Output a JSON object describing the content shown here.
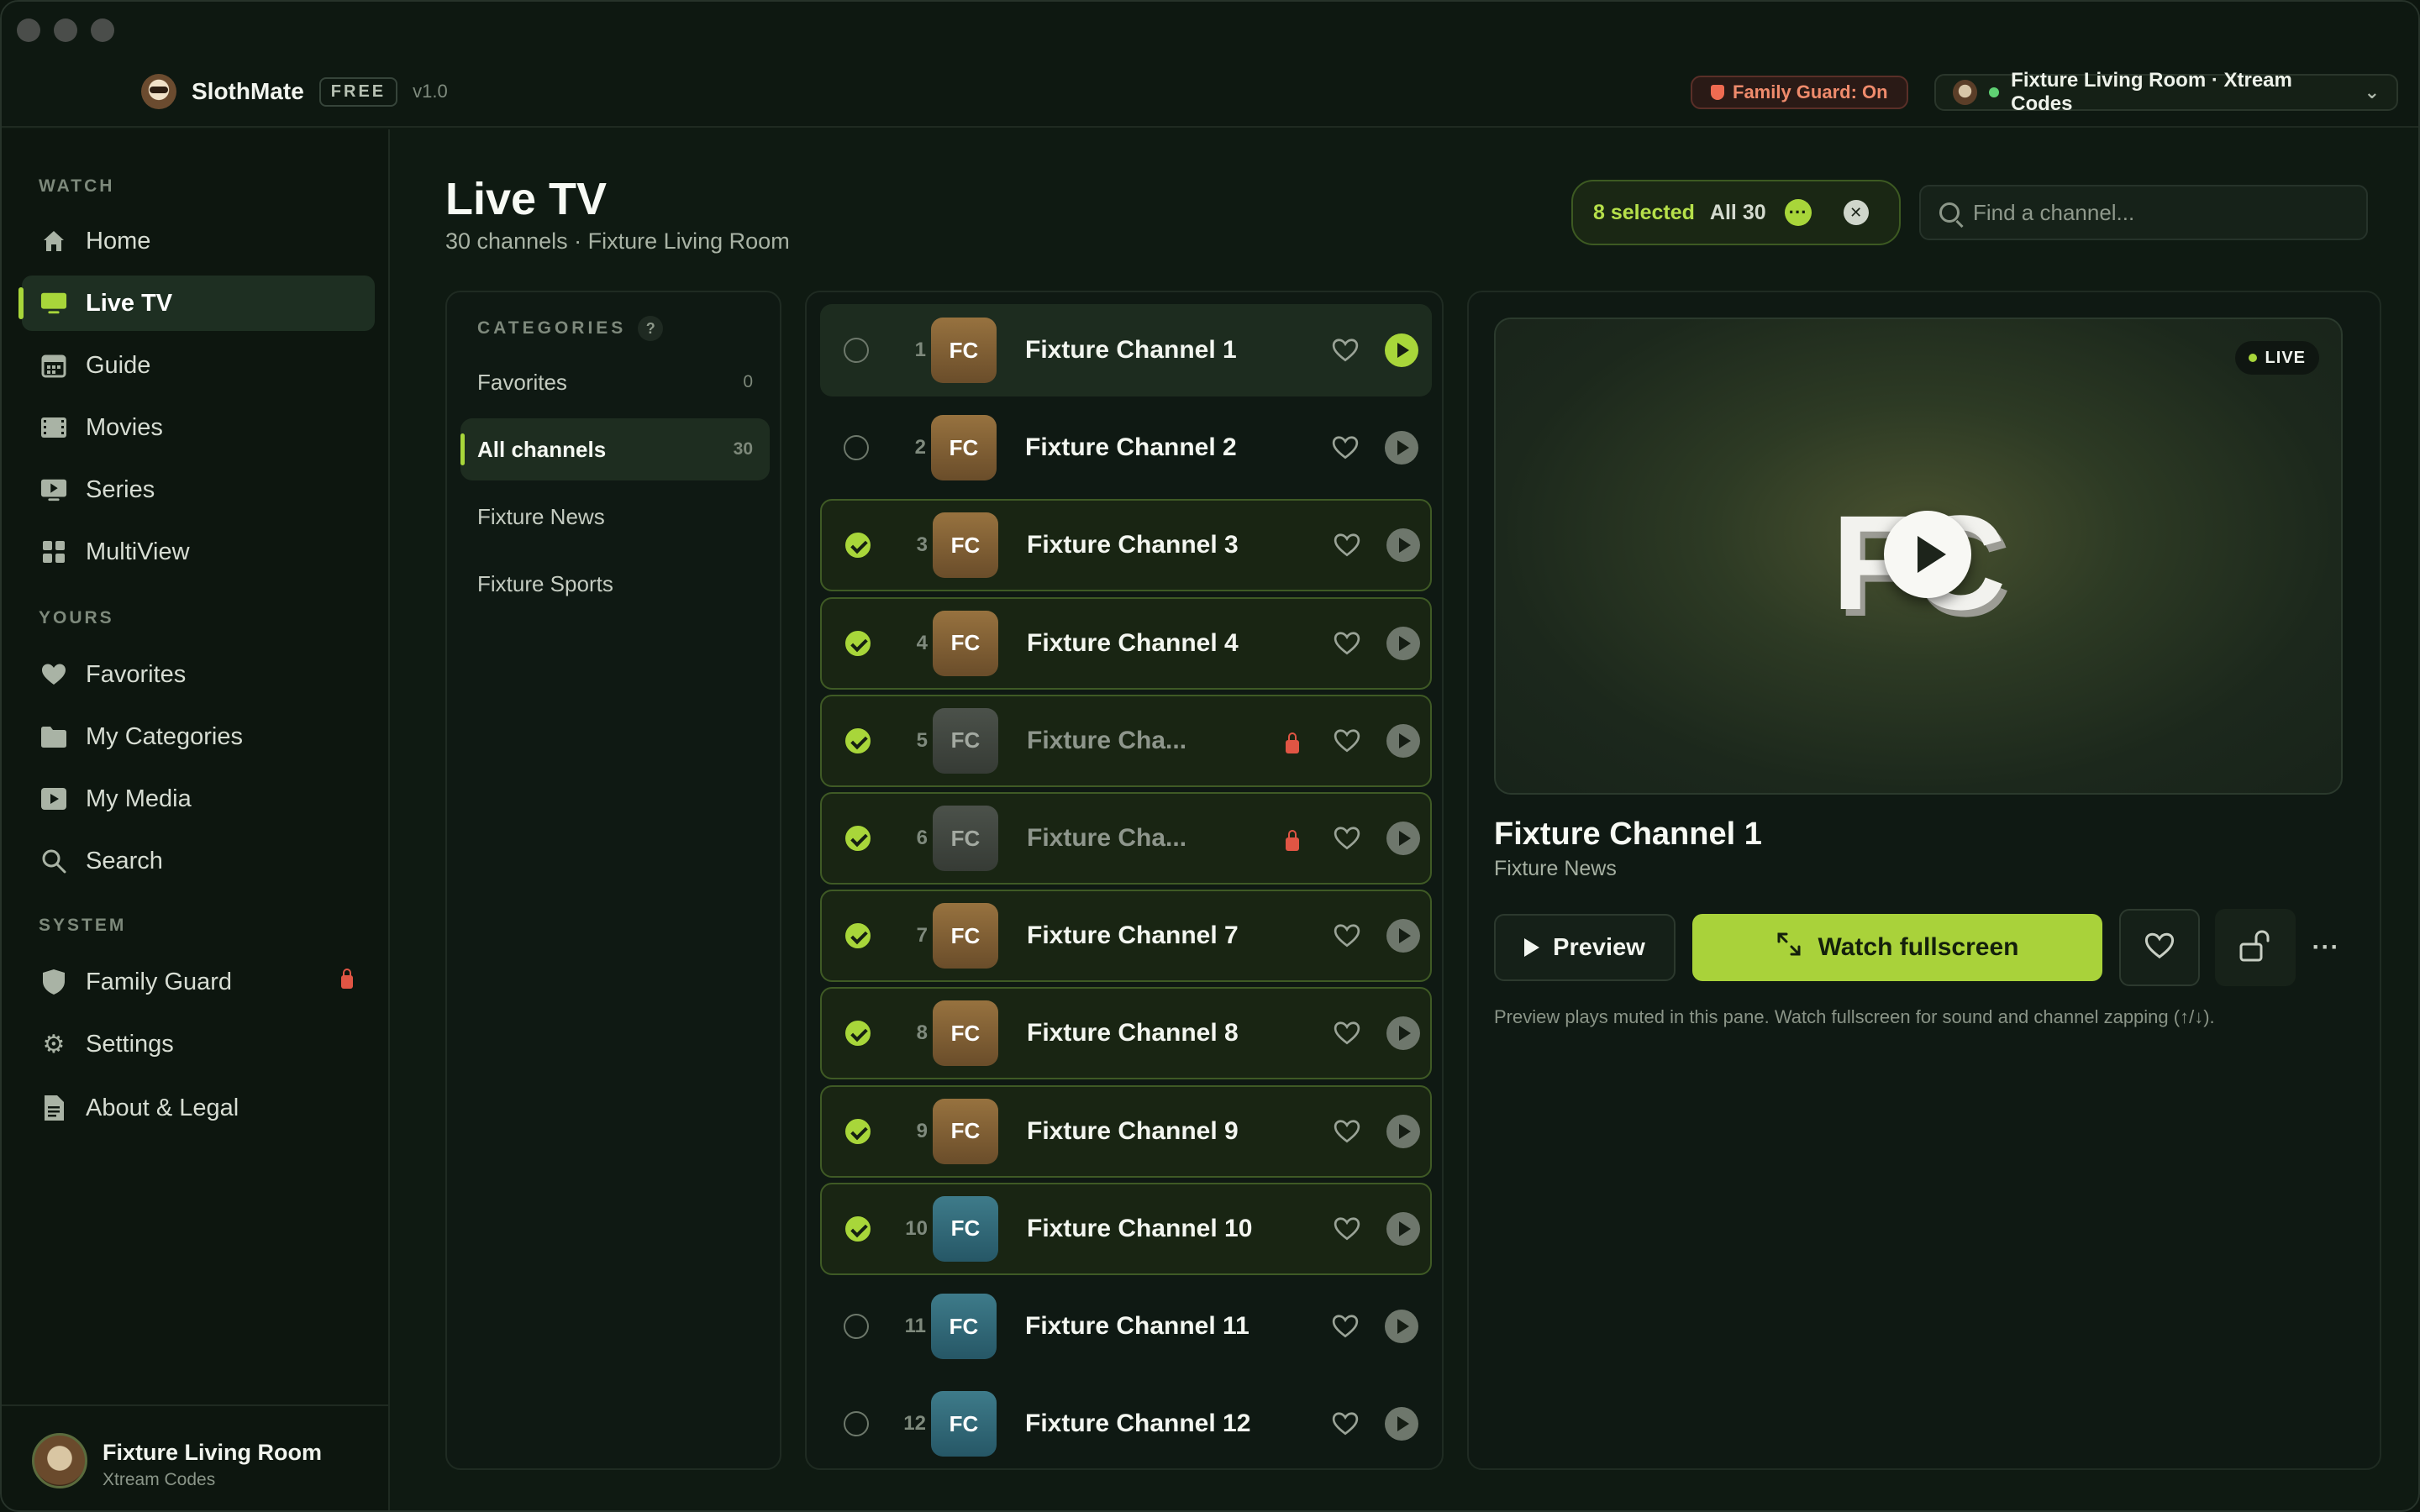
{
  "app": {
    "name": "SlothMate",
    "plan_badge": "FREE",
    "version": "v1.0",
    "family_guard_status": "Family Guard: On",
    "profile_switcher": "Fixture Living Room · Xtream Codes"
  },
  "sidebar": {
    "sections": [
      {
        "label": "WATCH",
        "items": [
          {
            "label": "Home",
            "icon": "home-icon"
          },
          {
            "label": "Live TV",
            "icon": "tv-icon",
            "active": true
          },
          {
            "label": "Guide",
            "icon": "calendar-icon"
          },
          {
            "label": "Movies",
            "icon": "film-icon"
          },
          {
            "label": "Series",
            "icon": "play-screen-icon"
          },
          {
            "label": "MultiView",
            "icon": "grid-icon"
          }
        ]
      },
      {
        "label": "YOURS",
        "items": [
          {
            "label": "Favorites",
            "icon": "heart-icon"
          },
          {
            "label": "My Categories",
            "icon": "folder-icon"
          },
          {
            "label": "My Media",
            "icon": "play-screen-icon"
          },
          {
            "label": "Search",
            "icon": "search-icon"
          }
        ]
      },
      {
        "label": "SYSTEM",
        "items": [
          {
            "label": "Family Guard",
            "icon": "shield-icon",
            "locked": true
          },
          {
            "label": "Settings",
            "icon": "gear-icon"
          },
          {
            "label": "About & Legal",
            "icon": "document-icon"
          }
        ]
      }
    ],
    "footer": {
      "name": "Fixture Living Room",
      "subtitle": "Xtream Codes"
    }
  },
  "header": {
    "title": "Live TV",
    "subtitle": "30 channels · Fixture Living Room",
    "selection": {
      "count_label": "8 selected",
      "all_label": "All 30"
    },
    "search": {
      "placeholder": "Find a channel..."
    }
  },
  "categories": {
    "title": "CATEGORIES",
    "help": "?",
    "items": [
      {
        "label": "Favorites",
        "count": "0"
      },
      {
        "label": "All channels",
        "count": "30",
        "active": true
      },
      {
        "label": "Fixture News",
        "count": ""
      },
      {
        "label": "Fixture Sports",
        "count": ""
      }
    ]
  },
  "channels": [
    {
      "num": "1",
      "logo": "FC",
      "name": "Fixture Channel 1",
      "selected": false,
      "playing": true,
      "locked": false,
      "logo_color": "brown"
    },
    {
      "num": "2",
      "logo": "FC",
      "name": "Fixture Channel 2",
      "selected": false,
      "playing": false,
      "locked": false,
      "logo_color": "brown"
    },
    {
      "num": "3",
      "logo": "FC",
      "name": "Fixture Channel 3",
      "selected": true,
      "playing": false,
      "locked": false,
      "logo_color": "brown"
    },
    {
      "num": "4",
      "logo": "FC",
      "name": "Fixture Channel 4",
      "selected": true,
      "playing": false,
      "locked": false,
      "logo_color": "brown"
    },
    {
      "num": "5",
      "logo": "FC",
      "name": "Fixture Cha...",
      "selected": true,
      "playing": false,
      "locked": true,
      "logo_color": "gray"
    },
    {
      "num": "6",
      "logo": "FC",
      "name": "Fixture Cha...",
      "selected": true,
      "playing": false,
      "locked": true,
      "logo_color": "gray"
    },
    {
      "num": "7",
      "logo": "FC",
      "name": "Fixture Channel 7",
      "selected": true,
      "playing": false,
      "locked": false,
      "logo_color": "brown"
    },
    {
      "num": "8",
      "logo": "FC",
      "name": "Fixture Channel 8",
      "selected": true,
      "playing": false,
      "locked": false,
      "logo_color": "brown"
    },
    {
      "num": "9",
      "logo": "FC",
      "name": "Fixture Channel 9",
      "selected": true,
      "playing": false,
      "locked": false,
      "logo_color": "brown"
    },
    {
      "num": "10",
      "logo": "FC",
      "name": "Fixture Channel 10",
      "selected": true,
      "playing": false,
      "locked": false,
      "logo_color": "teal"
    },
    {
      "num": "11",
      "logo": "FC",
      "name": "Fixture Channel 11",
      "selected": false,
      "playing": false,
      "locked": false,
      "logo_color": "teal"
    },
    {
      "num": "12",
      "logo": "FC",
      "name": "Fixture Channel 12",
      "selected": false,
      "playing": false,
      "locked": false,
      "logo_color": "teal"
    }
  ],
  "preview": {
    "live_badge": "LIVE",
    "logo_text": "FC",
    "title": "Fixture Channel 1",
    "category": "Fixture News",
    "preview_label": "Preview",
    "watch_label": "Watch fullscreen",
    "more_label": "···",
    "hint": "Preview plays muted in this pane. Watch fullscreen for sound and channel zapping (↑/↓)."
  },
  "colors": {
    "accent": "#a8d63a",
    "background": "#0f1a12",
    "danger": "#e05544"
  }
}
